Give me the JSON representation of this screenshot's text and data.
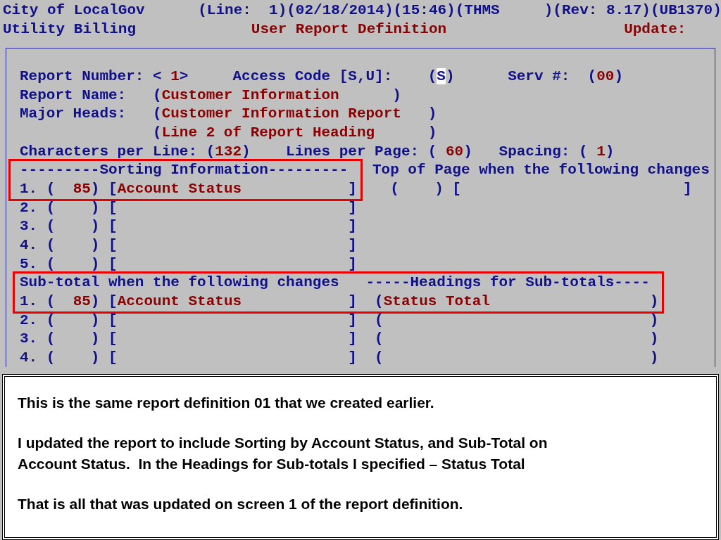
{
  "header": [
    [
      {
        "kind": "label",
        "text": "City of LocalGov      (Line:  1)(02/18/2014)(15:46)(THMS     )(Rev: 8.17)(UB1370)"
      }
    ],
    [
      {
        "kind": "label",
        "text": "Utility Billing"
      },
      {
        "kind": "value",
        "text": "             User Report Definition"
      },
      {
        "kind": "value",
        "text": "                    Update:"
      }
    ]
  ],
  "panel": [
    {
      "kind": "blank"
    },
    {
      "kind": "line",
      "segments": [
        {
          "kind": "label",
          "text": "Report Number: < "
        },
        {
          "kind": "value",
          "text": "1"
        },
        {
          "kind": "label",
          "text": ">     Access Code [S,U]:    ("
        },
        {
          "kind": "cursor",
          "text": "S"
        },
        {
          "kind": "label",
          "text": ")      Serv #:  ("
        },
        {
          "kind": "value",
          "text": "00"
        },
        {
          "kind": "label",
          "text": ")"
        }
      ]
    },
    {
      "kind": "line",
      "segments": [
        {
          "kind": "label",
          "text": "Report Name:   ("
        },
        {
          "kind": "value",
          "text": "Customer Information"
        },
        {
          "kind": "label",
          "text": "      )"
        }
      ]
    },
    {
      "kind": "line",
      "segments": [
        {
          "kind": "label",
          "text": "Major Heads:   ("
        },
        {
          "kind": "value",
          "text": "Customer Information Report"
        },
        {
          "kind": "label",
          "text": "   )"
        }
      ]
    },
    {
      "kind": "line",
      "segments": [
        {
          "kind": "label",
          "text": "               ("
        },
        {
          "kind": "value",
          "text": "Line 2 of Report Heading"
        },
        {
          "kind": "label",
          "text": "      )"
        }
      ]
    },
    {
      "kind": "line",
      "segments": [
        {
          "kind": "label",
          "text": "Characters per Line: ("
        },
        {
          "kind": "value",
          "text": "132"
        },
        {
          "kind": "label",
          "text": ")    Lines per Page: ( "
        },
        {
          "kind": "value",
          "text": "60"
        },
        {
          "kind": "label",
          "text": ")   Spacing: ( "
        },
        {
          "kind": "value",
          "text": "1"
        },
        {
          "kind": "label",
          "text": ")"
        }
      ]
    },
    {
      "kind": "split",
      "left": {
        "highlight": true,
        "lines": [
          [
            {
              "kind": "label",
              "text": "---------Sorting Information---------"
            }
          ],
          [
            {
              "kind": "label",
              "text": "1. (  "
            },
            {
              "kind": "value",
              "text": "85"
            },
            {
              "kind": "label",
              "text": ") ["
            },
            {
              "kind": "value",
              "text": "Account Status"
            },
            {
              "kind": "label",
              "text": "            ]"
            }
          ]
        ]
      },
      "right": {
        "highlight": false,
        "lines": [
          [
            {
              "kind": "label",
              "text": "Top of Page when the following changes"
            }
          ],
          [
            {
              "kind": "label",
              "text": "  (    ) [                         ]"
            }
          ]
        ]
      }
    },
    {
      "kind": "line",
      "segments": [
        {
          "kind": "label",
          "text": "2. (    ) [                          ]"
        }
      ]
    },
    {
      "kind": "line",
      "segments": [
        {
          "kind": "label",
          "text": "3. (    ) [                          ]"
        }
      ]
    },
    {
      "kind": "line",
      "segments": [
        {
          "kind": "label",
          "text": "4. (    ) [                          ]"
        }
      ]
    },
    {
      "kind": "line",
      "segments": [
        {
          "kind": "label",
          "text": "5. (    ) [                          ]"
        }
      ]
    },
    {
      "kind": "group",
      "highlight": true,
      "lines": [
        [
          {
            "kind": "label",
            "text": "Sub-total when the following changes   -----Headings for Sub-totals----"
          }
        ],
        [
          {
            "kind": "label",
            "text": "1. (  "
          },
          {
            "kind": "value",
            "text": "85"
          },
          {
            "kind": "label",
            "text": ") ["
          },
          {
            "kind": "value",
            "text": "Account Status"
          },
          {
            "kind": "label",
            "text": "            ]  ("
          },
          {
            "kind": "value",
            "text": "Status Total"
          },
          {
            "kind": "label",
            "text": "                  )"
          }
        ]
      ]
    },
    {
      "kind": "line",
      "segments": [
        {
          "kind": "label",
          "text": "2. (    ) [                          ]  (                              )"
        }
      ]
    },
    {
      "kind": "line",
      "segments": [
        {
          "kind": "label",
          "text": "3. (    ) [                          ]  (                              )"
        }
      ]
    },
    {
      "kind": "line",
      "segments": [
        {
          "kind": "label",
          "text": "4. (    ) [                          ]  (                              )"
        }
      ]
    }
  ],
  "callout": {
    "paragraphs": [
      "This is the same report definition 01 that we created earlier.",
      "I updated the report to include Sorting by Account Status, and Sub-Total on\nAccount Status.  In the Headings for Sub-totals I specified – Status Total",
      "That is all that was updated on screen 1 of the report definition."
    ]
  }
}
